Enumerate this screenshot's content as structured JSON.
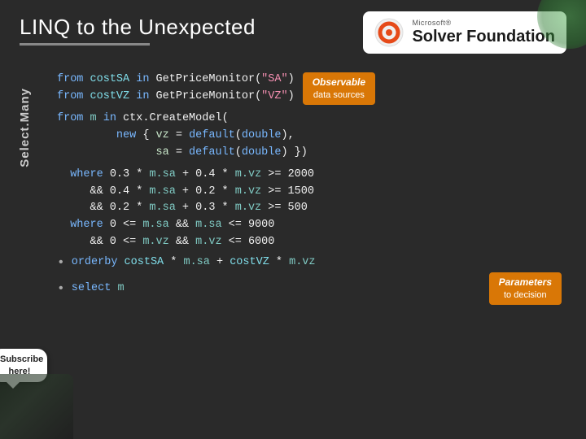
{
  "header": {
    "title": "LINQ to the Unexpected",
    "solver_microsoft": "Microsoft®",
    "solver_name": "Solver Foundation"
  },
  "code": {
    "line1a": "from costSA in GetPriceMonitor(\"SA\")",
    "line1b": "from costVZ in GetPriceMonitor(\"VZ\")",
    "observable_label": "Observable",
    "observable_sub": "data sources",
    "line2": "from m in ctx.CreateModel(",
    "line3": "         new { vz = default(double),",
    "line4": "               sa = default(double) })",
    "line5": "  where 0.3 * m.sa + 0.4 * m.vz >= 2000",
    "line6": "     && 0.4 * m.sa + 0.2 * m.vz >= 1500",
    "line7": "     && 0.2 * m.sa + 0.3 * m.vz >= 500",
    "line8": "  where 0 <= m.sa && m.sa <= 9000",
    "line9": "     && 0 <= m.vz && m.vz <= 6000",
    "line10": "  orderby costSA * m.sa + costVZ * m.vz",
    "line11": "  select m",
    "parameters_label": "Parameters",
    "parameters_sub": "to decision"
  },
  "sidebar": {
    "select_many": "Select.Many"
  },
  "subscribe": {
    "label": "Subscribe\nhere!"
  }
}
